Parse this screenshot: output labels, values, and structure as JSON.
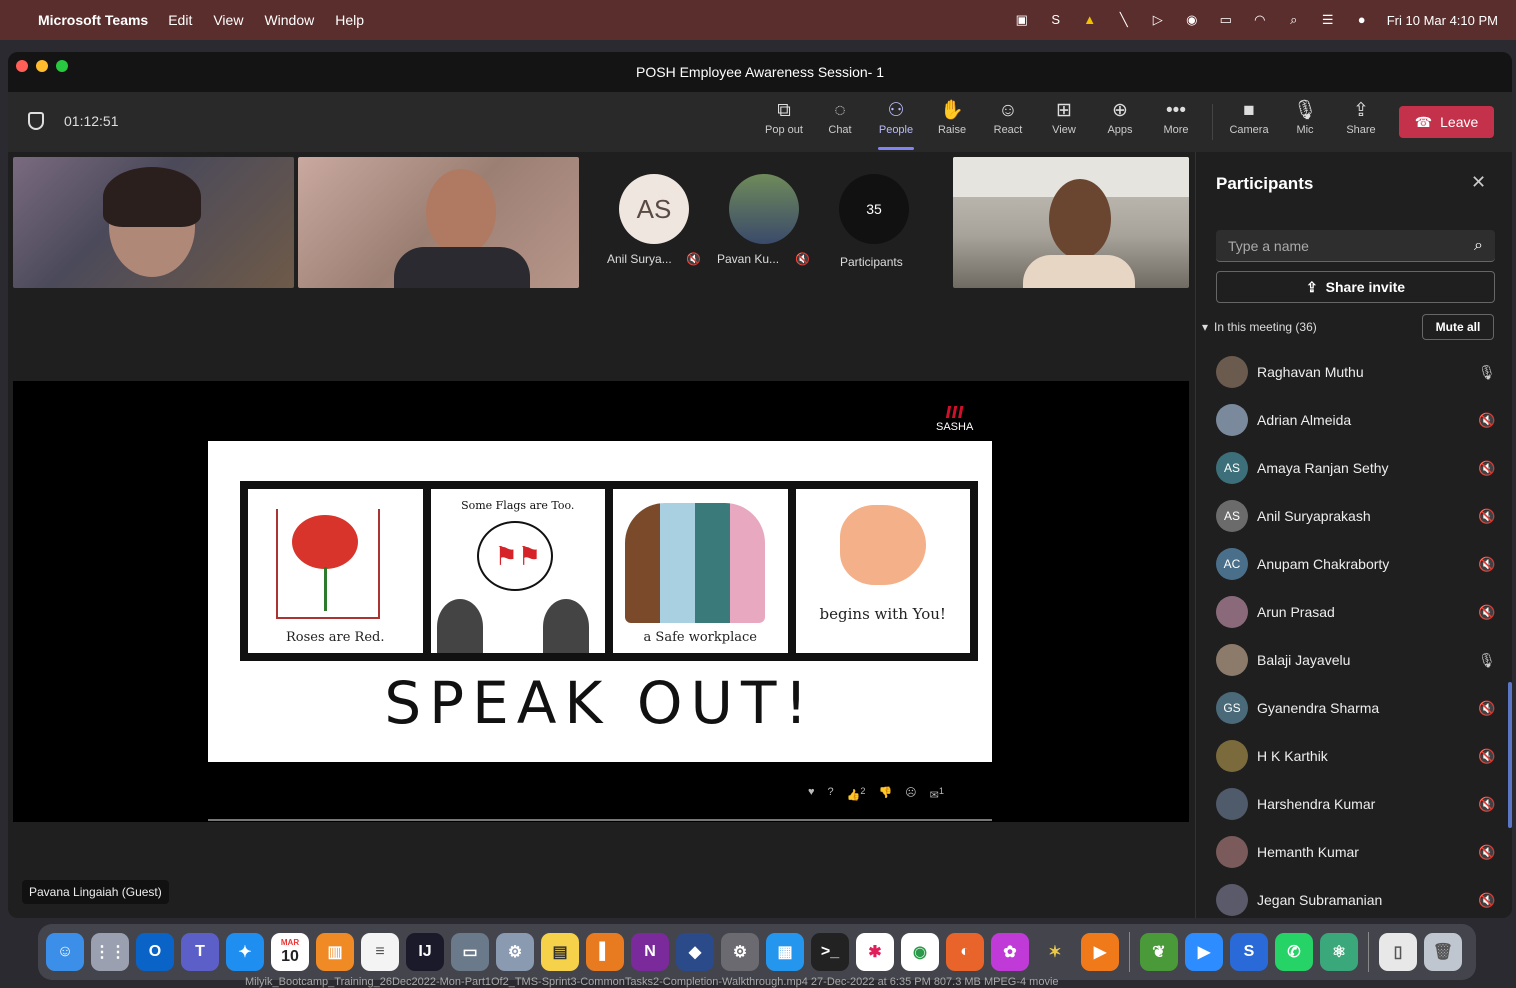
{
  "menubar": {
    "app_name": "Microsoft Teams",
    "items": [
      "Edit",
      "View",
      "Window",
      "Help"
    ],
    "clock": "Fri 10 Mar  4:10 PM"
  },
  "window": {
    "title": "POSH Employee Awareness Session- 1"
  },
  "meeting": {
    "timer": "01:12:51",
    "tools": [
      {
        "label": "Pop out",
        "icon": "pop-out-icon"
      },
      {
        "label": "Chat",
        "icon": "chat-icon"
      },
      {
        "label": "People",
        "icon": "people-icon"
      },
      {
        "label": "Raise",
        "icon": "raise-hand-icon"
      },
      {
        "label": "React",
        "icon": "react-icon"
      },
      {
        "label": "View",
        "icon": "view-icon"
      },
      {
        "label": "Apps",
        "icon": "apps-icon"
      },
      {
        "label": "More",
        "icon": "more-icon"
      }
    ],
    "device_tools": [
      {
        "label": "Camera",
        "icon": "camera-icon"
      },
      {
        "label": "Mic",
        "icon": "mic-icon"
      },
      {
        "label": "Share",
        "icon": "share-icon"
      }
    ],
    "leave_label": "Leave",
    "active_tool": "People"
  },
  "stage": {
    "avatars": [
      {
        "initials": "AS",
        "name": "Anil Surya...",
        "muted": true
      },
      {
        "initials": "",
        "name": "Pavan Ku...",
        "muted": true
      }
    ],
    "participants_count": "35",
    "participants_label": "Participants",
    "presenter_chip": "Pavana Lingaiah (Guest)"
  },
  "slide": {
    "logo_text": "SASHA",
    "panels": [
      {
        "caption": "Roses are Red."
      },
      {
        "caption": "Some Flags are Too."
      },
      {
        "caption": "a Safe workplace"
      },
      {
        "caption": "begins with You!"
      }
    ],
    "headline": "SPEAK OUT!",
    "reaction_counts": {
      "like": "2",
      "other": "1"
    }
  },
  "participants_panel": {
    "title": "Participants",
    "search_placeholder": "Type a name",
    "share_invite": "Share invite",
    "section_label": "In this meeting (36)",
    "mute_all": "Mute all",
    "people": [
      {
        "name": "Raghavan Muthu",
        "initials": "",
        "color": "#6b5a4e",
        "mic": "on"
      },
      {
        "name": "Adrian Almeida",
        "initials": "",
        "color": "#7a8a9c",
        "mic": "off"
      },
      {
        "name": "Amaya Ranjan Sethy",
        "initials": "AS",
        "color": "#3d6f7a",
        "mic": "off"
      },
      {
        "name": "Anil Suryaprakash",
        "initials": "AS",
        "color": "#6b6b6b",
        "mic": "off"
      },
      {
        "name": "Anupam Chakraborty",
        "initials": "AC",
        "color": "#4a6f8a",
        "mic": "off"
      },
      {
        "name": "Arun Prasad",
        "initials": "",
        "color": "#8a6a7a",
        "mic": "off"
      },
      {
        "name": "Balaji Jayavelu",
        "initials": "",
        "color": "#8c7a6a",
        "mic": "on"
      },
      {
        "name": "Gyanendra Sharma",
        "initials": "GS",
        "color": "#4a6a7a",
        "mic": "off"
      },
      {
        "name": "H K Karthik",
        "initials": "",
        "color": "#7a6a3c",
        "mic": "off"
      },
      {
        "name": "Harshendra Kumar",
        "initials": "",
        "color": "#4f5a6a",
        "mic": "off"
      },
      {
        "name": "Hemanth Kumar",
        "initials": "",
        "color": "#7a5a5a",
        "mic": "off"
      },
      {
        "name": "Jegan Subramanian",
        "initials": "",
        "color": "#5a5a6a",
        "mic": "off"
      }
    ]
  },
  "dock": {
    "calendar_month": "MAR",
    "calendar_day": "10"
  },
  "status_text": "Milyik_Bootcamp_Training_26Dec2022-Mon-Part1Of2_TMS-Sprint3-CommonTasks2-Completion-Walkthrough.mp4   27-Dec-2022 at 6:35 PM   807.3 MB   MPEG-4 movie"
}
